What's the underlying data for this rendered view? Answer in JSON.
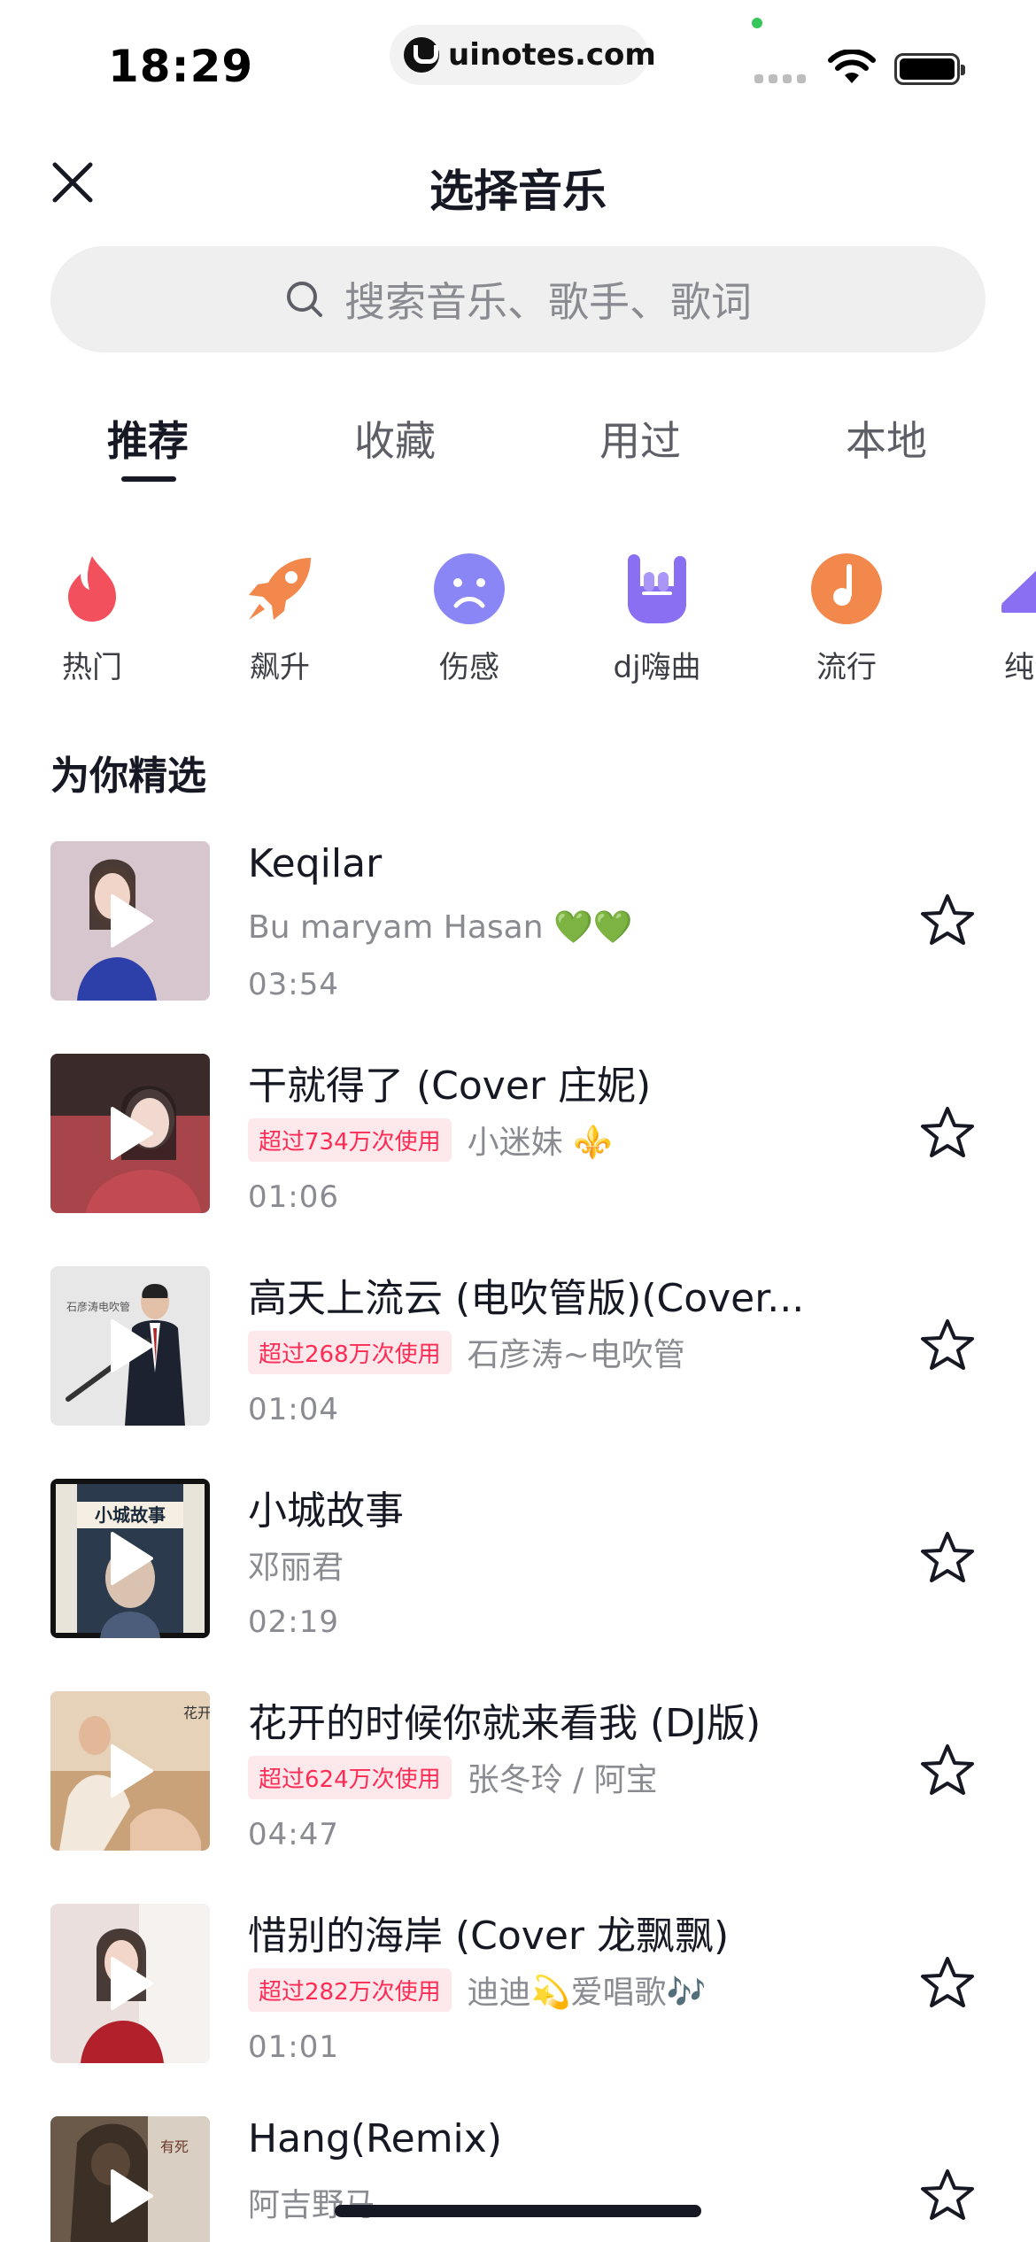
{
  "status_bar": {
    "time": "18:29",
    "url": "uinotes.com"
  },
  "header": {
    "title": "选择音乐"
  },
  "search": {
    "placeholder": "搜索音乐、歌手、歌词"
  },
  "tabs": [
    {
      "label": "推荐",
      "active": true
    },
    {
      "label": "收藏",
      "active": false
    },
    {
      "label": "用过",
      "active": false
    },
    {
      "label": "本地",
      "active": false
    }
  ],
  "categories": [
    {
      "label": "热门",
      "icon": "flame-icon",
      "color": "#f2505d"
    },
    {
      "label": "飙升",
      "icon": "rocket-icon",
      "color": "#f2884b"
    },
    {
      "label": "伤感",
      "icon": "sad-face-icon",
      "color": "#8b86f5"
    },
    {
      "label": "dj嗨曲",
      "icon": "rock-hand-icon",
      "color": "#8b6ff2"
    },
    {
      "label": "流行",
      "icon": "vinyl-note-icon",
      "color": "#f2884b"
    },
    {
      "label": "纯音",
      "icon": "piano-icon",
      "color": "#8b6ff2"
    }
  ],
  "section": {
    "title": "为你精选"
  },
  "songs": [
    {
      "title": "Keqilar",
      "badge": "",
      "artist": "Bu maryam Hasan 💚💚",
      "duration": "03:54",
      "cover_color": "#d8c6cf"
    },
    {
      "title": "干就得了 (Cover 庄妮)",
      "badge": "超过734万次使用",
      "artist": "小迷妹 ⚜️",
      "duration": "01:06",
      "cover_color": "#a8454b"
    },
    {
      "title": "高天上流云 (电吹管版)(Cover...",
      "badge": "超过268万次使用",
      "artist": "石彦涛~电吹管",
      "duration": "01:04",
      "cover_color": "#e7e7e7"
    },
    {
      "title": "小城故事",
      "badge": "",
      "artist": "邓丽君",
      "duration": "02:19",
      "cover_color": "#2b3a4d"
    },
    {
      "title": "花开的时候你就来看我 (DJ版)",
      "badge": "超过624万次使用",
      "artist": "张冬玲 / 阿宝",
      "duration": "04:47",
      "cover_color": "#c9a27a"
    },
    {
      "title": "惜别的海岸 (Cover 龙飘飘)",
      "badge": "超过282万次使用",
      "artist": "迪迪💫爱唱歌🎶",
      "duration": "01:01",
      "cover_color": "#eadfdc"
    },
    {
      "title": "Hang(Remix)",
      "badge": "",
      "artist": "阿吉野马",
      "duration": "",
      "cover_color": "#6b5a4a"
    }
  ],
  "colors": {
    "accent": "#fe2c55",
    "text_primary": "#161823",
    "text_secondary": "#8a8b91"
  }
}
